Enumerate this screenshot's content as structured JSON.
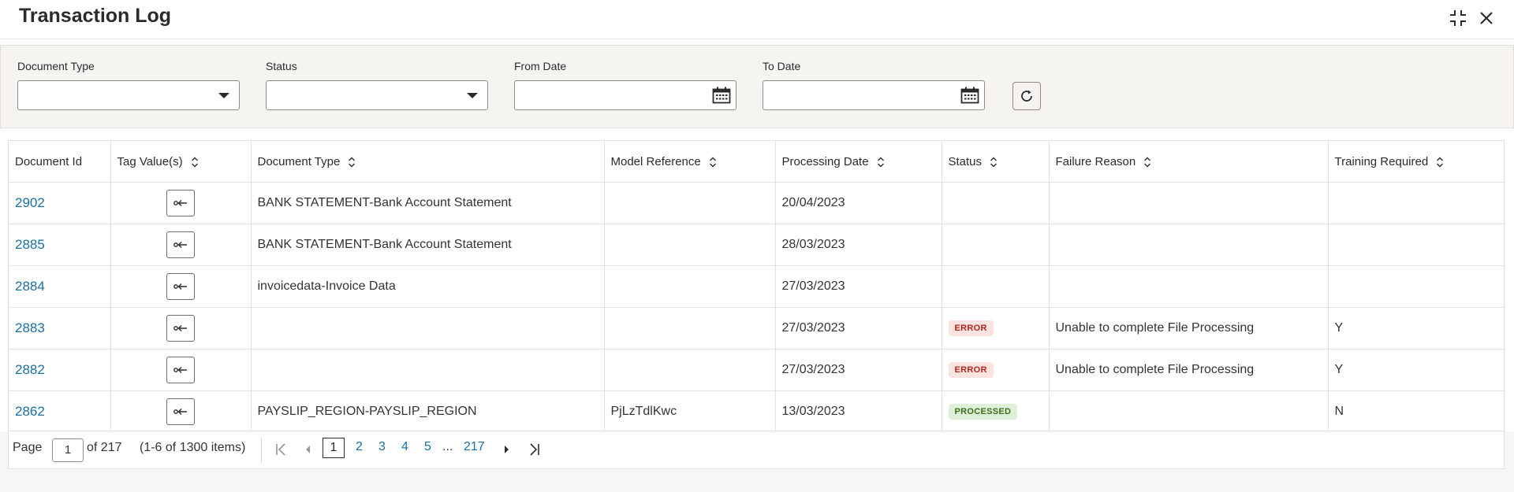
{
  "window": {
    "title": "Transaction Log"
  },
  "filters": {
    "document_type_label": "Document Type",
    "document_type_value": "",
    "status_label": "Status",
    "status_value": "",
    "from_date_label": "From Date",
    "from_date_value": "",
    "to_date_label": "To Date",
    "to_date_value": ""
  },
  "table": {
    "columns": [
      "Document Id",
      "Tag Value(s)",
      "Document Type",
      "Model Reference",
      "Processing Date",
      "Status",
      "Failure Reason",
      "Training Required"
    ],
    "rows": [
      {
        "id": "2902",
        "doc_type": "BANK STATEMENT-Bank Account Statement",
        "model_ref": "",
        "date": "20/04/2023",
        "status": "",
        "failure": "",
        "training": ""
      },
      {
        "id": "2885",
        "doc_type": "BANK STATEMENT-Bank Account Statement",
        "model_ref": "",
        "date": "28/03/2023",
        "status": "",
        "failure": "",
        "training": ""
      },
      {
        "id": "2884",
        "doc_type": "invoicedata-Invoice Data",
        "model_ref": "",
        "date": "27/03/2023",
        "status": "",
        "failure": "",
        "training": ""
      },
      {
        "id": "2883",
        "doc_type": "",
        "model_ref": "",
        "date": "27/03/2023",
        "status": "ERROR",
        "failure": "Unable to complete File Processing",
        "training": "Y"
      },
      {
        "id": "2882",
        "doc_type": "",
        "model_ref": "",
        "date": "27/03/2023",
        "status": "ERROR",
        "failure": "Unable to complete File Processing",
        "training": "Y"
      },
      {
        "id": "2862",
        "doc_type": "PAYSLIP_REGION-PAYSLIP_REGION",
        "model_ref": "PjLzTdlKwc",
        "date": "13/03/2023",
        "status": "PROCESSED",
        "failure": "",
        "training": "N"
      }
    ]
  },
  "pagination": {
    "page_label": "Page",
    "current_page": "1",
    "of_text": "of 217",
    "items_text": "(1-6 of 1300 items)",
    "pages": [
      "1",
      "2",
      "3",
      "4",
      "5"
    ],
    "ellipsis": "...",
    "last_page": "217"
  },
  "colors": {
    "link": "#1a6fa3",
    "error_bg": "#fbe3df",
    "error_text": "#b3261e",
    "processed_bg": "#dff0d8",
    "processed_text": "#3c6e1e"
  },
  "icons": [
    "expand-icon",
    "close-icon",
    "dropdown-arrow-icon",
    "calendar-icon",
    "refresh-icon",
    "sort-icon",
    "tag-value-icon",
    "first-page-icon",
    "previous-page-icon",
    "next-page-icon",
    "last-page-icon"
  ]
}
